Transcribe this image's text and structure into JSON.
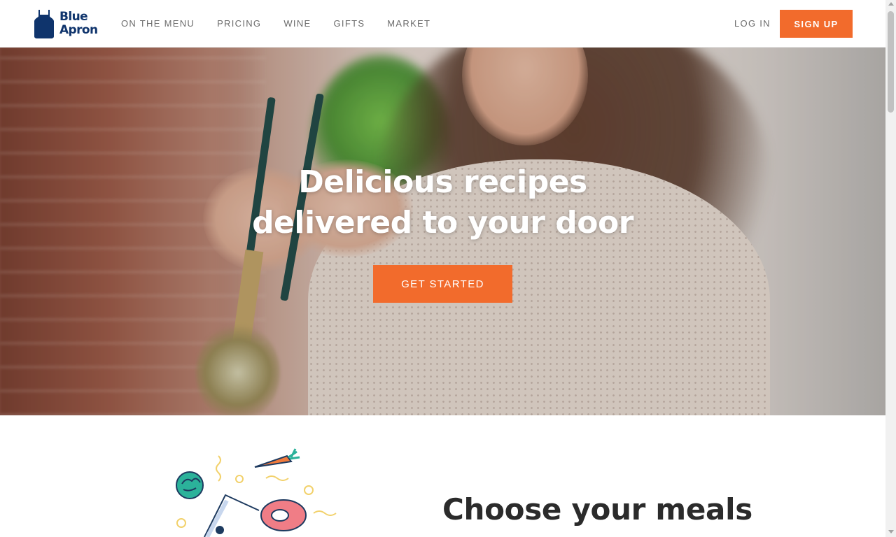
{
  "header": {
    "logo": {
      "line1": "Blue",
      "line2": "Apron"
    },
    "nav": [
      {
        "label": "ON THE MENU"
      },
      {
        "label": "PRICING"
      },
      {
        "label": "WINE"
      },
      {
        "label": "GIFTS"
      },
      {
        "label": "MARKET"
      }
    ],
    "login_label": "LOG IN",
    "signup_label": "SIGN UP"
  },
  "hero": {
    "title_line1": "Delicious recipes",
    "title_line2": "delivered to your door",
    "cta_label": "GET STARTED"
  },
  "section": {
    "title": "Choose your meals"
  },
  "colors": {
    "brand_blue": "#0f346c",
    "accent_orange": "#f26b2c",
    "nav_text": "#6b6b6b"
  }
}
